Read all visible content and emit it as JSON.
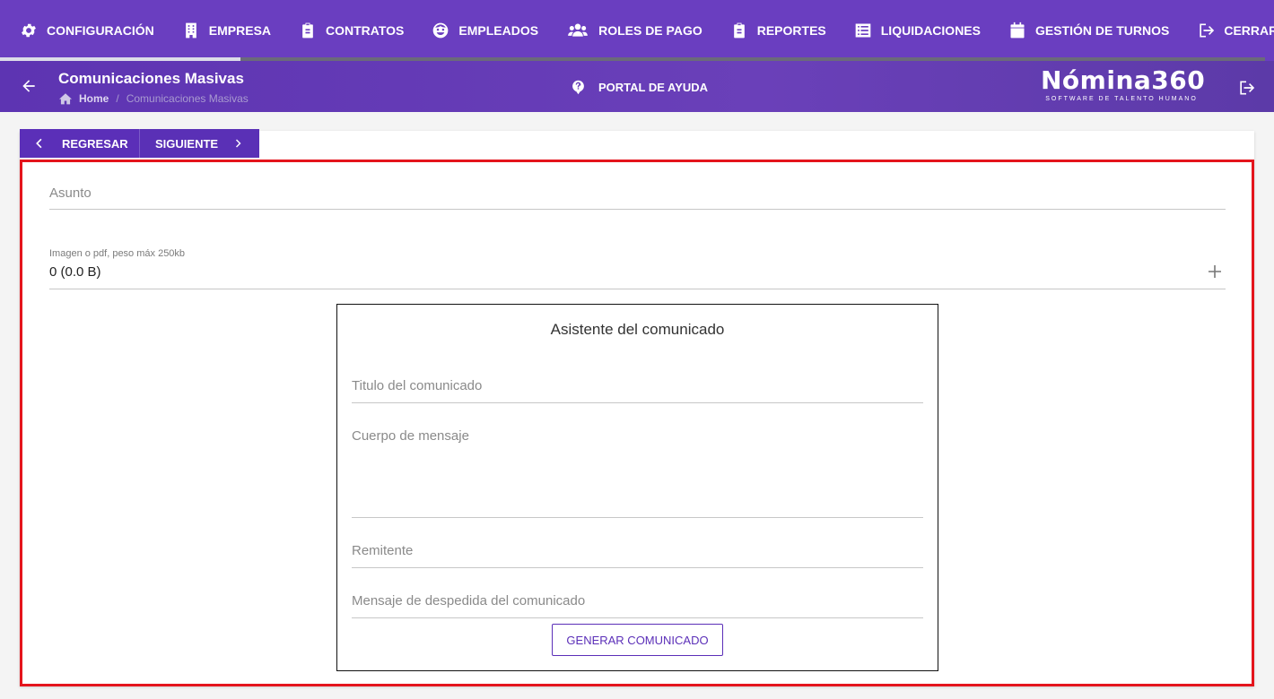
{
  "nav": {
    "items": [
      {
        "label": "CONFIGURACIÓN",
        "icon": "gear-icon"
      },
      {
        "label": "EMPRESA",
        "icon": "building-icon"
      },
      {
        "label": "CONTRATOS",
        "icon": "clipboard-icon"
      },
      {
        "label": "EMPLEADOS",
        "icon": "face-icon"
      },
      {
        "label": "ROLES DE PAGO",
        "icon": "users-icon"
      },
      {
        "label": "REPORTES",
        "icon": "clipboard-list-icon"
      },
      {
        "label": "LIQUIDACIONES",
        "icon": "list-icon"
      },
      {
        "label": "GESTIÓN DE TURNOS",
        "icon": "calendar-icon"
      },
      {
        "label": "CERRAR SESIÓN",
        "icon": "logout-icon"
      }
    ],
    "progress": 0.19
  },
  "header": {
    "title": "Comunicaciones Masivas",
    "breadcrumb_home": "Home",
    "breadcrumb_sep": "/",
    "breadcrumb_current": "Comunicaciones Masivas",
    "help_label": "PORTAL DE AYUDA",
    "logo_main": "Nómina360",
    "logo_sub": "SOFTWARE DE TALENTO HUMANO"
  },
  "toolbar": {
    "back_label": "REGRESAR",
    "next_label": "SIGUIENTE"
  },
  "form": {
    "asunto_placeholder": "Asunto",
    "file_label": "Imagen o pdf, peso máx 250kb",
    "file_value": "0 (0.0 B)"
  },
  "wizard": {
    "title": "Asistente del comunicado",
    "titulo_placeholder": "Titulo del comunicado",
    "cuerpo_placeholder": "Cuerpo de mensaje",
    "remitente_placeholder": "Remitente",
    "despedida_placeholder": "Mensaje de despedida del comunicado",
    "generate_label": "GENERAR COMUNICADO"
  },
  "colors": {
    "brand_purple": "#6a3ec0",
    "highlight_red": "#e4141c"
  }
}
